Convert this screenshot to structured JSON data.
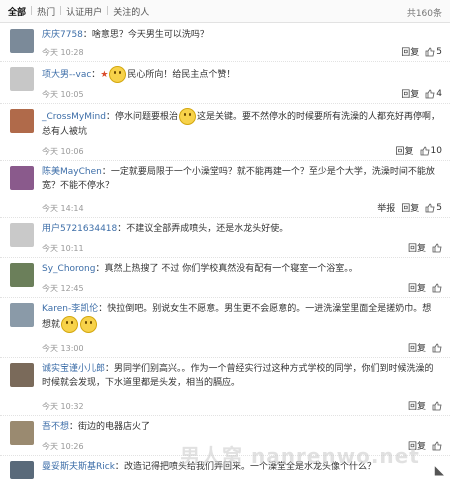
{
  "tabs": {
    "all": "全部",
    "hot": "热门",
    "verified": "认证用户",
    "following": "关注的人",
    "sep": "|",
    "total": "共160条"
  },
  "comments": [
    {
      "user": "庆庆7758",
      "text": "啥意思？今天男生可以洗吗？",
      "time": "今天 10:28",
      "reply": "回复",
      "likes": "5",
      "avatar_color": "#7b8a99"
    },
    {
      "user": "项大男--vac",
      "text": "民心所向！给民主点个赞！",
      "time": "今天 10:05",
      "reply": "回复",
      "likes": "4",
      "avatar_color": "#c7c7c7"
    },
    {
      "user": "_CrossMyMind",
      "text": "停水问题要根治",
      "text2": "这是关键。要不然停水的时候要所有洗澡的人都充好再停啊，总有人被坑",
      "time": "今天 10:06",
      "reply": "回复",
      "likes": "10",
      "avatar_color": "#b06a4a"
    },
    {
      "user": "陈美MayChen",
      "text": "一定就要局限于一个小澡堂吗？就不能再建一个？至少是个大学，洗澡时间不能放宽？不能不停水？",
      "time": "今天 14:14",
      "report": "举报",
      "reply": "回复",
      "likes": "5",
      "avatar_color": "#8a5a8c"
    },
    {
      "user": "用户5721634418",
      "text": "不建议全部弄成喷头，还是水龙头好使。",
      "time": "今天 10:11",
      "reply": "回复",
      "likes": "",
      "avatar_color": "#c9c9c9"
    },
    {
      "user": "Sy_Chorong",
      "text": "真然上热搜了 不过 你们学校真然没有配有一个寝室一个浴室。。",
      "time": "今天 12:45",
      "reply": "回复",
      "likes": "",
      "avatar_color": "#6b7f5a"
    },
    {
      "user": "Karen-李凯伦",
      "text": "快拉倒吧。别说女生不愿意。男生更不会愿意的。一进洗澡堂里面全是搓奶巾。想想就",
      "time": "今天 13:00",
      "reply": "回复",
      "likes": "",
      "avatar_color": "#8a9aa8"
    },
    {
      "user": "诚实宝谨小儿郎",
      "text": "男同学们别高兴。。作为一个曾经实行过这种方式学校的同学，你们到时候洗澡的时候就会发现，下水道里都是头发，相当的膈应。",
      "time": "今天 10:32",
      "reply": "回复",
      "likes": "",
      "avatar_color": "#7a6a5a"
    },
    {
      "user": "吾不想",
      "text": "街边的电器店火了",
      "time": "今天 10:26",
      "reply": "回复",
      "likes": "",
      "avatar_color": "#9a8a70"
    },
    {
      "user": "曼妥斯夫斯基Rick",
      "text": "改造记得把喷头给我们弄回来。一个澡堂全是水龙头像个什么？",
      "time": "",
      "reply": "",
      "likes": "",
      "avatar_color": "#5a6a7a"
    }
  ],
  "watermark": "男人窝 nanrenwo.net"
}
